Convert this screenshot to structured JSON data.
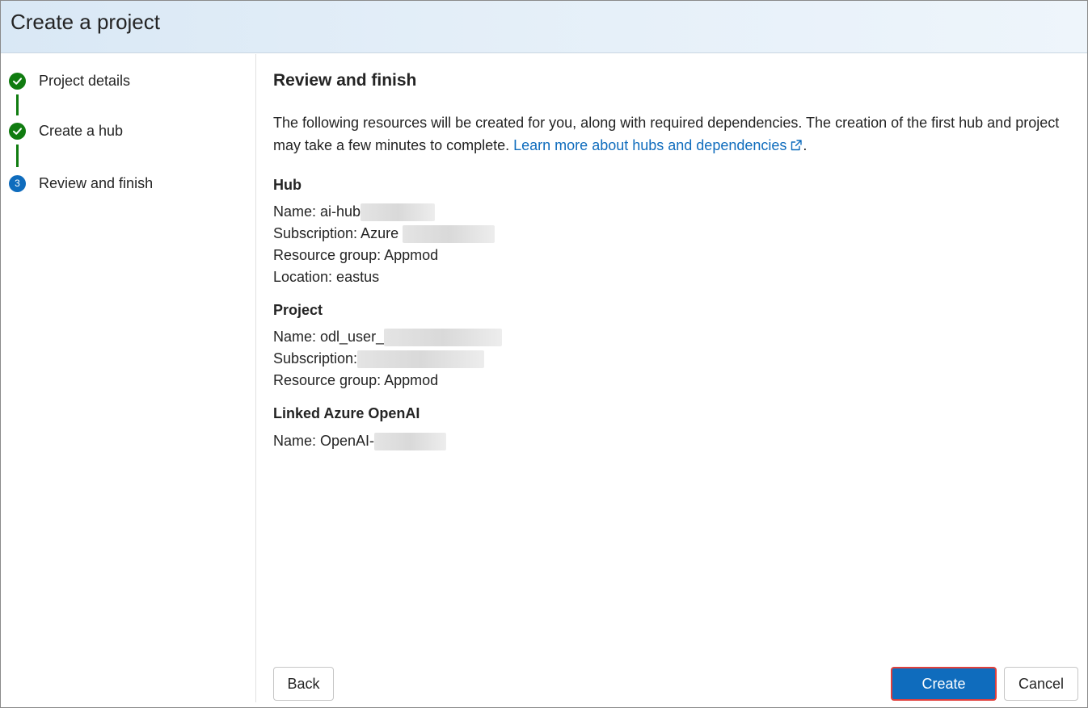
{
  "header": {
    "title": "Create a project"
  },
  "steps": [
    {
      "label": "Project details",
      "status": "done"
    },
    {
      "label": "Create a hub",
      "status": "done"
    },
    {
      "label": "Review and finish",
      "status": "current",
      "number": "3"
    }
  ],
  "main": {
    "title": "Review and finish",
    "intro_text": "The following resources will be created for you, along with required dependencies. The creation of the first hub and project may take a few minutes to complete.",
    "learn_more_label": "Learn more about hubs and dependencies",
    "hub": {
      "heading": "Hub",
      "name_label": "Name: ai-hub",
      "subscription_label": "Subscription: Azure",
      "resource_group_label": "Resource group: Appmod",
      "location_label": "Location: eastus"
    },
    "project": {
      "heading": "Project",
      "name_label": "Name: odl_user_",
      "subscription_label": "Subscription:",
      "resource_group_label": "Resource group: Appmod"
    },
    "openai": {
      "heading": "Linked Azure OpenAI",
      "name_label": "Name: OpenAI-"
    }
  },
  "footer": {
    "back_label": "Back",
    "create_label": "Create",
    "cancel_label": "Cancel"
  },
  "colors": {
    "accent": "#0f6cbd",
    "success": "#107c10",
    "highlight_border": "#e0403c"
  }
}
